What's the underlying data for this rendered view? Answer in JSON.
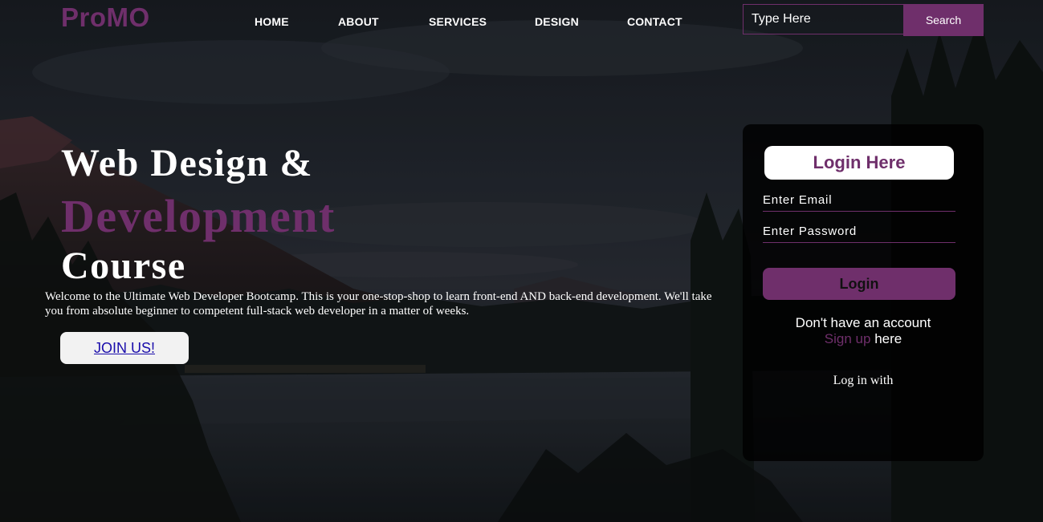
{
  "brand": {
    "logo": "ProMO",
    "accent_color": "#6f2f6b"
  },
  "nav": {
    "items": [
      {
        "label": "HOME"
      },
      {
        "label": "ABOUT"
      },
      {
        "label": "SERVICES"
      },
      {
        "label": "DESIGN"
      },
      {
        "label": "CONTACT"
      }
    ]
  },
  "search": {
    "placeholder": "Type Here",
    "button_label": "Search"
  },
  "hero": {
    "line1": "Web Design &",
    "line2": "Development",
    "line3": "Course",
    "description": "Welcome to the Ultimate Web Developer Bootcamp. This is your one-stop-shop to learn front-end AND back-end development. We'll take you from absolute beginner to competent full-stack web developer in a matter of weeks.",
    "cta_label": "JOIN US!"
  },
  "login": {
    "title": "Login Here",
    "email_placeholder": "Enter Email",
    "password_placeholder": "Enter Password",
    "button_label": "Login",
    "no_account_text": "Don't have an account",
    "signup_link": "Sign up",
    "signup_suffix": "here",
    "login_with": "Log in with"
  }
}
